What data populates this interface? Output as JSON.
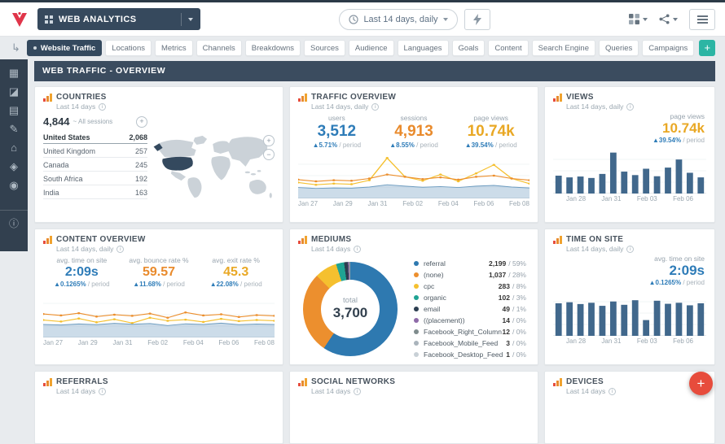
{
  "topbar": {
    "workspace_label": "WEB ANALYTICS",
    "date_range_label": "Last 14 days, daily"
  },
  "tabs": {
    "return_icon": "↳",
    "items": [
      {
        "id": "tab-website-traffic",
        "label": "Website Traffic",
        "cls": "active"
      },
      {
        "id": "tab-locations",
        "label": "Locations"
      },
      {
        "id": "tab-metrics",
        "label": "Metrics"
      },
      {
        "id": "tab-channels",
        "label": "Channels"
      },
      {
        "id": "tab-breakdowns",
        "label": "Breakdowns"
      },
      {
        "id": "tab-sources",
        "label": "Sources"
      },
      {
        "id": "tab-audience",
        "label": "Audience"
      },
      {
        "id": "tab-languages",
        "label": "Languages"
      },
      {
        "id": "tab-goals",
        "label": "Goals"
      },
      {
        "id": "tab-content",
        "label": "Content"
      },
      {
        "id": "tab-search-engine",
        "label": "Search Engine"
      },
      {
        "id": "tab-queries",
        "label": "Queries"
      },
      {
        "id": "tab-campaigns",
        "label": "Campaigns"
      }
    ],
    "add_label": "+"
  },
  "sidebar": {
    "icons": [
      {
        "name": "dashboard-icon",
        "glyph": "▦"
      },
      {
        "name": "reports-icon",
        "glyph": "◪"
      },
      {
        "name": "clipboard-icon",
        "glyph": "▤"
      },
      {
        "name": "edit-icon",
        "glyph": "✎"
      },
      {
        "name": "bank-icon",
        "glyph": "⌂"
      },
      {
        "name": "tag-icon",
        "glyph": "◈"
      },
      {
        "name": "user-icon",
        "glyph": "◉"
      },
      {
        "name": "info-icon",
        "glyph": "ⓘ"
      }
    ]
  },
  "page_header": {
    "title": "WEB TRAFFIC - OVERVIEW"
  },
  "colors": {
    "navy": "#34495e",
    "teal": "#2cb5a4",
    "metric_blue": "#2e7cb8",
    "metric_orange": "#e98b2d",
    "metric_gold": "#e9a825",
    "bar_blue": "#41688c",
    "fab_red": "#e74c3c"
  },
  "panels": {
    "countries": {
      "title": "COUNTRIES",
      "subtitle": "Last 14 days",
      "total_value": "4,844",
      "total_note": "~ All sessions",
      "add_icon": "+",
      "zoom_in": "+",
      "zoom_out": "−",
      "rows": [
        {
          "label": "United States",
          "value": "2,068",
          "cls": "strong"
        },
        {
          "label": "United Kingdom",
          "value": "257"
        },
        {
          "label": "Canada",
          "value": "245"
        },
        {
          "label": "South Africa",
          "value": "192"
        },
        {
          "label": "India",
          "value": "163"
        }
      ]
    },
    "traffic": {
      "title": "TRAFFIC OVERVIEW",
      "subtitle": "Last 14 days, daily",
      "metrics": [
        {
          "label": "users",
          "value": "3,512",
          "delta": "▲5.71%",
          "period": "/ period"
        },
        {
          "label": "sessions",
          "value": "4,913",
          "delta": "▲8.55%",
          "period": "/ period"
        },
        {
          "label": "page views",
          "value": "10.74k",
          "delta": "▲39.54%",
          "period": "/ period"
        }
      ],
      "chart": {
        "type": "line",
        "series": [
          {
            "name": "page views",
            "color": "#f5c02f",
            "ymax": 1600,
            "values": [
              560,
              480,
              520,
              500,
              640,
              1420,
              760,
              620,
              840,
              600,
              880,
              1180,
              700,
              520
            ]
          },
          {
            "name": "sessions",
            "color": "#ec8f2e",
            "ymax": 800,
            "values": [
              330,
              300,
              320,
              310,
              350,
              420,
              380,
              340,
              370,
              330,
              380,
              400,
              350,
              320
            ]
          },
          {
            "name": "users",
            "color": "#6d9cc0",
            "ymax": 1000,
            "area": true,
            "values": [
              240,
              220,
              230,
              225,
              250,
              300,
              270,
              245,
              260,
              240,
              270,
              285,
              250,
              230
            ]
          }
        ]
      },
      "x_labels": [
        "Jan 27",
        "Jan 29",
        "Jan 31",
        "Feb 02",
        "Feb 04",
        "Feb 06",
        "Feb 08"
      ]
    },
    "views": {
      "title": "VIEWS",
      "subtitle": "Last 14 days, daily",
      "metric": {
        "label": "page views",
        "value": "10.74k",
        "delta": "▲39.54%",
        "period": "/ period"
      },
      "chart": {
        "type": "bar",
        "color": "#41688c",
        "ymax": 1500,
        "values": [
          620,
          560,
          590,
          540,
          680,
          1420,
          760,
          640,
          860,
          600,
          900,
          1180,
          720,
          560
        ]
      },
      "x_labels": [
        "Jan 28",
        "Jan 31",
        "Feb 03",
        "Feb 06"
      ]
    },
    "content_overview": {
      "title": "CONTENT OVERVIEW",
      "subtitle": "Last 14 days, daily",
      "metrics": [
        {
          "label": "avg. time on site",
          "value": "2:09s",
          "delta": "▲0.1265%",
          "period": "/ period"
        },
        {
          "label": "avg. bounce rate %",
          "value": "59.57",
          "delta": "▲11.68%",
          "period": "/ period"
        },
        {
          "label": "avg. exit rate %",
          "value": "45.3",
          "delta": "▲22.08%",
          "period": "/ period"
        }
      ],
      "chart": {
        "type": "line",
        "series": [
          {
            "name": "bounce rate",
            "color": "#ec8f2e",
            "ymax": 120,
            "values": [
              62,
              58,
              64,
              55,
              60,
              57,
              63,
              52,
              66,
              58,
              61,
              54,
              59,
              57
            ]
          },
          {
            "name": "exit rate",
            "color": "#f5c02f",
            "ymax": 120,
            "values": [
              46,
              42,
              50,
              40,
              48,
              38,
              52,
              44,
              47,
              41,
              49,
              43,
              46,
              44
            ]
          },
          {
            "name": "time on site",
            "color": "#6d9cc0",
            "ymax": 420,
            "area": true,
            "values": [
              120,
              115,
              125,
              118,
              130,
              122,
              128,
              110,
              126,
              120,
              132,
              118,
              124,
              120
            ]
          }
        ]
      },
      "x_labels": [
        "Jan 27",
        "Jan 29",
        "Jan 31",
        "Feb 02",
        "Feb 04",
        "Feb 06",
        "Feb 08"
      ]
    },
    "mediums": {
      "title": "MEDIUMS",
      "subtitle": "Last 14 days",
      "total_label": "total",
      "total_value": "3,700",
      "legend": [
        {
          "label": "referral",
          "value": "2,199",
          "share": "/ 59%",
          "n": 2199,
          "color": "#2e79b0"
        },
        {
          "label": "(none)",
          "value": "1,037",
          "share": "/ 28%",
          "n": 1037,
          "color": "#ec8f2e"
        },
        {
          "label": "cpc",
          "value": "283",
          "share": "/ 8%",
          "n": 283,
          "color": "#f5c02f"
        },
        {
          "label": "organic",
          "value": "102",
          "share": "/ 3%",
          "n": 102,
          "color": "#1fa393"
        },
        {
          "label": "email",
          "value": "49",
          "share": "/ 1%",
          "n": 49,
          "color": "#2c3e50"
        },
        {
          "label": "((placement))",
          "value": "14",
          "share": "/ 0%",
          "n": 14,
          "color": "#8e6aa8"
        },
        {
          "label": "Facebook_Right_Column",
          "value": "12",
          "share": "/ 0%",
          "n": 12,
          "color": "#7f8c8d"
        },
        {
          "label": "Facebook_Mobile_Feed",
          "value": "3",
          "share": "/ 0%",
          "n": 3,
          "color": "#aab4bc"
        },
        {
          "label": "Facebook_Desktop_Feed",
          "value": "1",
          "share": "/ 0%",
          "n": 1,
          "color": "#c8d0d6"
        }
      ]
    },
    "time_on_site": {
      "title": "TIME ON SITE",
      "subtitle": "Last 14 days, daily",
      "metric": {
        "label": "avg. time on site",
        "value": "2:09s",
        "delta": "▲0.1265%",
        "period": "/ period"
      },
      "chart": {
        "type": "bar",
        "color": "#41688c",
        "ymax": 170,
        "values": [
          128,
          132,
          125,
          130,
          118,
          135,
          122,
          140,
          62,
          138,
          126,
          130,
          120,
          128
        ]
      },
      "x_labels": [
        "Jan 28",
        "Jan 31",
        "Feb 03",
        "Feb 06"
      ]
    },
    "referrals": {
      "title": "REFERRALS",
      "subtitle": "Last 14 days"
    },
    "social_networks": {
      "title": "SOCIAL NETWORKS",
      "subtitle": "Last 14 days"
    },
    "devices": {
      "title": "DEVICES",
      "subtitle": "Last 14 days"
    }
  },
  "fab": {
    "label": "+"
  }
}
